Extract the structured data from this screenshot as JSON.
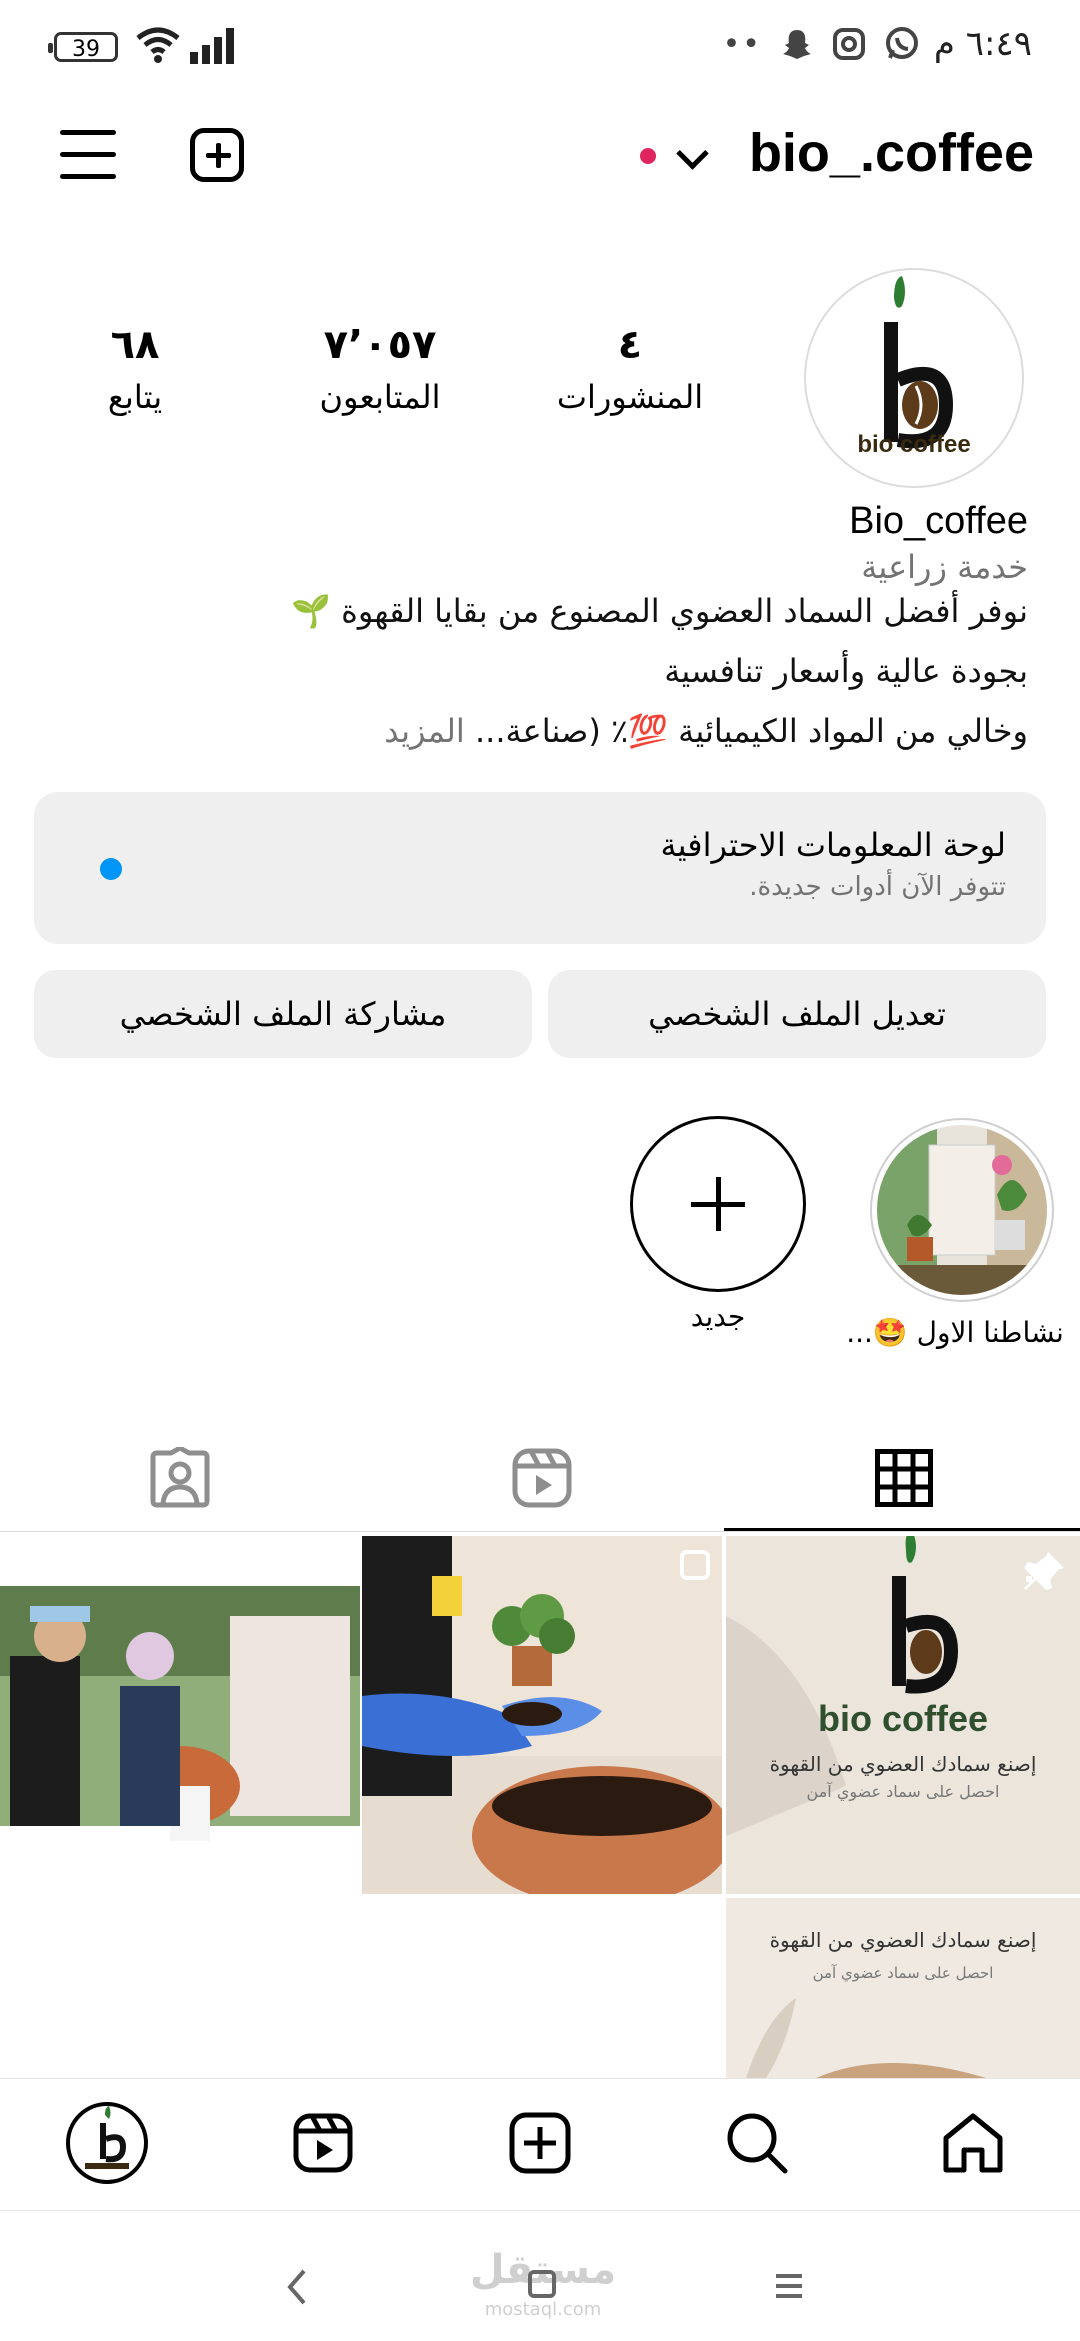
{
  "status_bar": {
    "time": "٦:٤٩ م",
    "battery": "39"
  },
  "header": {
    "username": "bio_.coffee"
  },
  "profile": {
    "logo_text": "bio coffee",
    "stats": [
      {
        "value": "٤",
        "label": "المنشورات"
      },
      {
        "value": "٧٬٠٥٧",
        "label": "المتابعون"
      },
      {
        "value": "٦٨",
        "label": "يتابع"
      }
    ],
    "name": "Bio_coffee",
    "category": "خدمة زراعية",
    "bio_lines": [
      "نوفر أفضل السماد العضوي المصنوع من بقايا القهوة 🌱",
      "بجودة عالية وأسعار تنافسية",
      "وخالي من المواد الكيميائية 💯٪ (صناعة..."
    ],
    "more_label": "المزيد"
  },
  "dashboard": {
    "title": "لوحة المعلومات الاحترافية",
    "subtitle": "تتوفر الآن أدوات جديدة."
  },
  "buttons": {
    "edit_profile": "تعديل الملف الشخصي",
    "share_profile": "مشاركة الملف الشخصي"
  },
  "highlights": [
    {
      "label": "نشاطنا الاول 🤩..."
    },
    {
      "label": "جديد"
    }
  ],
  "posts": {
    "post1_logo": "bio coffee",
    "post1_caption": "إصنع سمادك العضوي من القهوة",
    "post1_sub": "احصل على سماد عضوي آمن",
    "post4_caption": "إصنع سمادك العضوي من القهوة",
    "post4_sub": "احصل على سماد عضوي آمن"
  },
  "watermark": "مستقل",
  "watermark_sub": "mostaql.com",
  "colors": {
    "accent_blue": "#0095f6",
    "notif_red": "#e0245e",
    "button_bg": "#efefef"
  }
}
